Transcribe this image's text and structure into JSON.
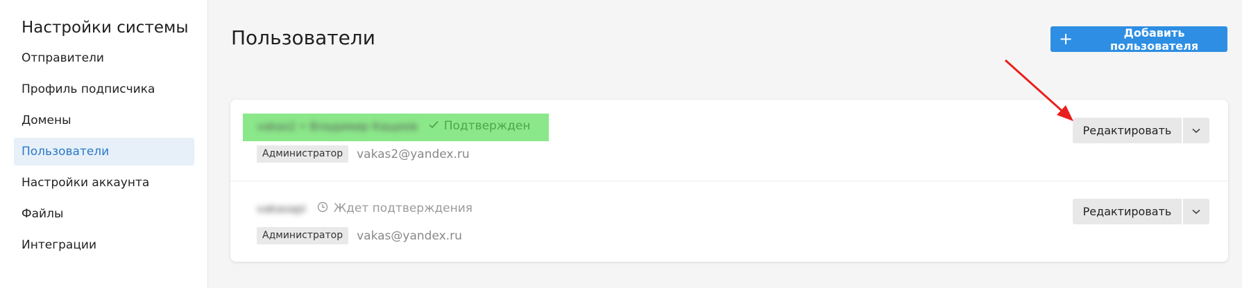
{
  "sidebar": {
    "title": "Настройки системы",
    "items": [
      {
        "label": "Отправители",
        "active": false
      },
      {
        "label": "Профиль подписчика",
        "active": false
      },
      {
        "label": "Домены",
        "active": false
      },
      {
        "label": "Пользователи",
        "active": true
      },
      {
        "label": "Настройки аккаунта",
        "active": false
      },
      {
        "label": "Файлы",
        "active": false
      },
      {
        "label": "Интеграции",
        "active": false
      }
    ]
  },
  "main": {
    "title": "Пользователи",
    "add_button": {
      "label": "Добавить пользователя",
      "icon": "plus-icon"
    },
    "users": [
      {
        "name": "vakas2 • Владимир Кащеев",
        "status": "Подтвержден",
        "status_icon": "check-icon",
        "role": "Администратор",
        "email": "vakas2@yandex.ru",
        "edit_label": "Редактировать",
        "highlighted": true
      },
      {
        "name": "vakasapi",
        "status": "Ждет подтверждения",
        "status_icon": "clock-icon",
        "role": "Администратор",
        "email": "vakas@yandex.ru",
        "edit_label": "Редактировать",
        "highlighted": false
      }
    ]
  },
  "colors": {
    "accent": "#2d8ee3",
    "active_nav_bg": "#e7f0f9",
    "active_nav_text": "#2b78c5",
    "highlight": "#8be88a",
    "confirmed": "#4ea44d",
    "annotation_arrow": "#e8201e"
  }
}
